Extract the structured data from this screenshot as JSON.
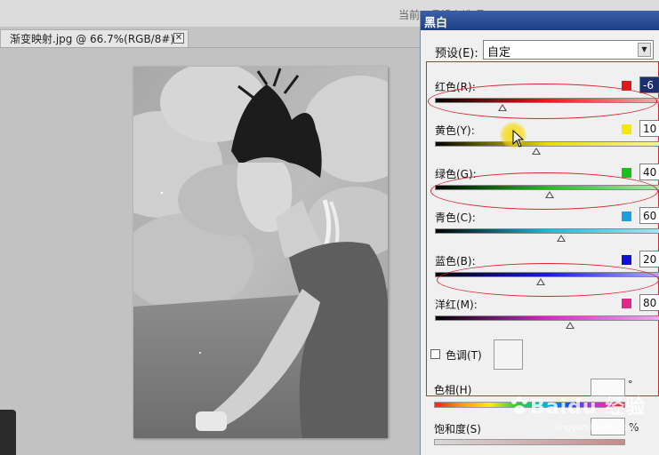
{
  "window": {
    "top_hint": "当前工具没有选项"
  },
  "document": {
    "tab_label": "渐变映射.jpg @ 66.7%(RGB/8#) *",
    "close_glyph": "✕"
  },
  "dialog": {
    "title": "黑白",
    "preset_label": "预设(E):",
    "preset_value": "自定",
    "sliders": [
      {
        "id": "red",
        "label": "红色(R):",
        "value": "-6",
        "swatch": "#e01818",
        "gradient": [
          "#000000",
          "#e81c1c",
          "#f4a9a9"
        ],
        "level": 0.3,
        "active": true
      },
      {
        "id": "yellow",
        "label": "黄色(Y):",
        "value": "10",
        "swatch": "#f4ea00",
        "gradient": [
          "#000000",
          "#e8e000",
          "#f7f39a"
        ],
        "level": 0.45,
        "active": false
      },
      {
        "id": "green",
        "label": "绿色(G):",
        "value": "40",
        "swatch": "#18c018",
        "gradient": [
          "#000000",
          "#20c020",
          "#a6eaa6"
        ],
        "level": 0.51,
        "active": false
      },
      {
        "id": "cyan",
        "label": "青色(C):",
        "value": "60",
        "swatch": "#1aa0e0",
        "gradient": [
          "#000000",
          "#20b8d8",
          "#a6e4f0"
        ],
        "level": 0.56,
        "active": false
      },
      {
        "id": "blue",
        "label": "蓝色(B):",
        "value": "20",
        "swatch": "#1010d8",
        "gradient": [
          "#000000",
          "#1a1ae0",
          "#a8a8f4"
        ],
        "level": 0.47,
        "active": false
      },
      {
        "id": "magenta",
        "label": "洋红(M):",
        "value": "80",
        "swatch": "#e02a8a",
        "gradient": [
          "#000000",
          "#d02ad0",
          "#f0a6f0"
        ],
        "level": 0.6,
        "active": false
      }
    ],
    "tint_label": "色调(T)",
    "hue_label": "色相(H)",
    "degree_symbol": "°",
    "saturation_label": "饱和度(S)",
    "percent_symbol": "%"
  },
  "watermark": {
    "main": "Baidu 经验",
    "sub": "jingyan.baidu.com"
  },
  "colors": {
    "annotation_red": "#d6262f",
    "title_bar": "#1e3f86",
    "cursor_highlight": "#f8d800"
  }
}
